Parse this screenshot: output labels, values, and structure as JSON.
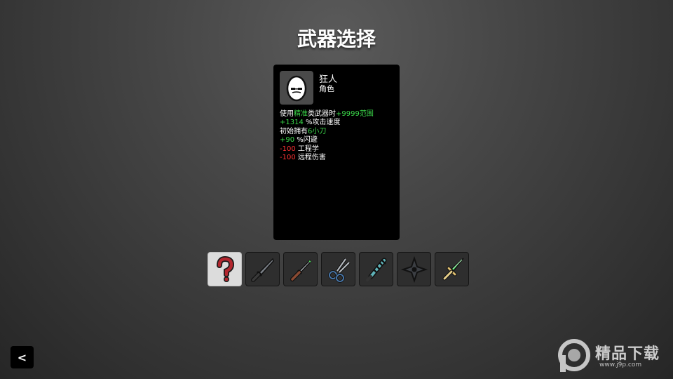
{
  "screen": {
    "title": "武器选择"
  },
  "character": {
    "name": "狂人",
    "type": "角色",
    "portrait_icon": "egg-face-icon",
    "lines": [
      {
        "parts": [
          {
            "text": "使用",
            "color": "white"
          },
          {
            "text": "精准",
            "color": "green"
          },
          {
            "text": "类武器时",
            "color": "white"
          },
          {
            "text": "+9999范围",
            "color": "green"
          }
        ]
      },
      {
        "parts": [
          {
            "text": "+1314",
            "color": "green"
          },
          {
            "text": " %攻击速度",
            "color": "white"
          }
        ]
      },
      {
        "parts": [
          {
            "text": "初始拥有",
            "color": "white"
          },
          {
            "text": "6小刀",
            "color": "green"
          }
        ]
      },
      {
        "parts": [
          {
            "text": "+90",
            "color": "green"
          },
          {
            "text": " %闪避",
            "color": "white"
          }
        ]
      },
      {
        "parts": [
          {
            "text": "-100",
            "color": "red"
          },
          {
            "text": " 工程学",
            "color": "white"
          }
        ]
      },
      {
        "parts": [
          {
            "text": "-100",
            "color": "red"
          },
          {
            "text": " 远程伤害",
            "color": "white"
          }
        ]
      }
    ]
  },
  "weapons": [
    {
      "icon": "random-question-icon",
      "selected": true
    },
    {
      "icon": "knife-icon",
      "selected": false
    },
    {
      "icon": "dagger-icon",
      "selected": false
    },
    {
      "icon": "scissors-icon",
      "selected": false
    },
    {
      "icon": "spiked-blade-icon",
      "selected": false
    },
    {
      "icon": "shuriken-icon",
      "selected": false
    },
    {
      "icon": "emerald-dagger-icon",
      "selected": false
    }
  ],
  "back_button": {
    "label": "<"
  },
  "watermark": {
    "text": "精品下载",
    "url": "www.j9p.com"
  },
  "colors": {
    "green": "#3bd94a",
    "red": "#ff3333",
    "panel": "#000000"
  }
}
